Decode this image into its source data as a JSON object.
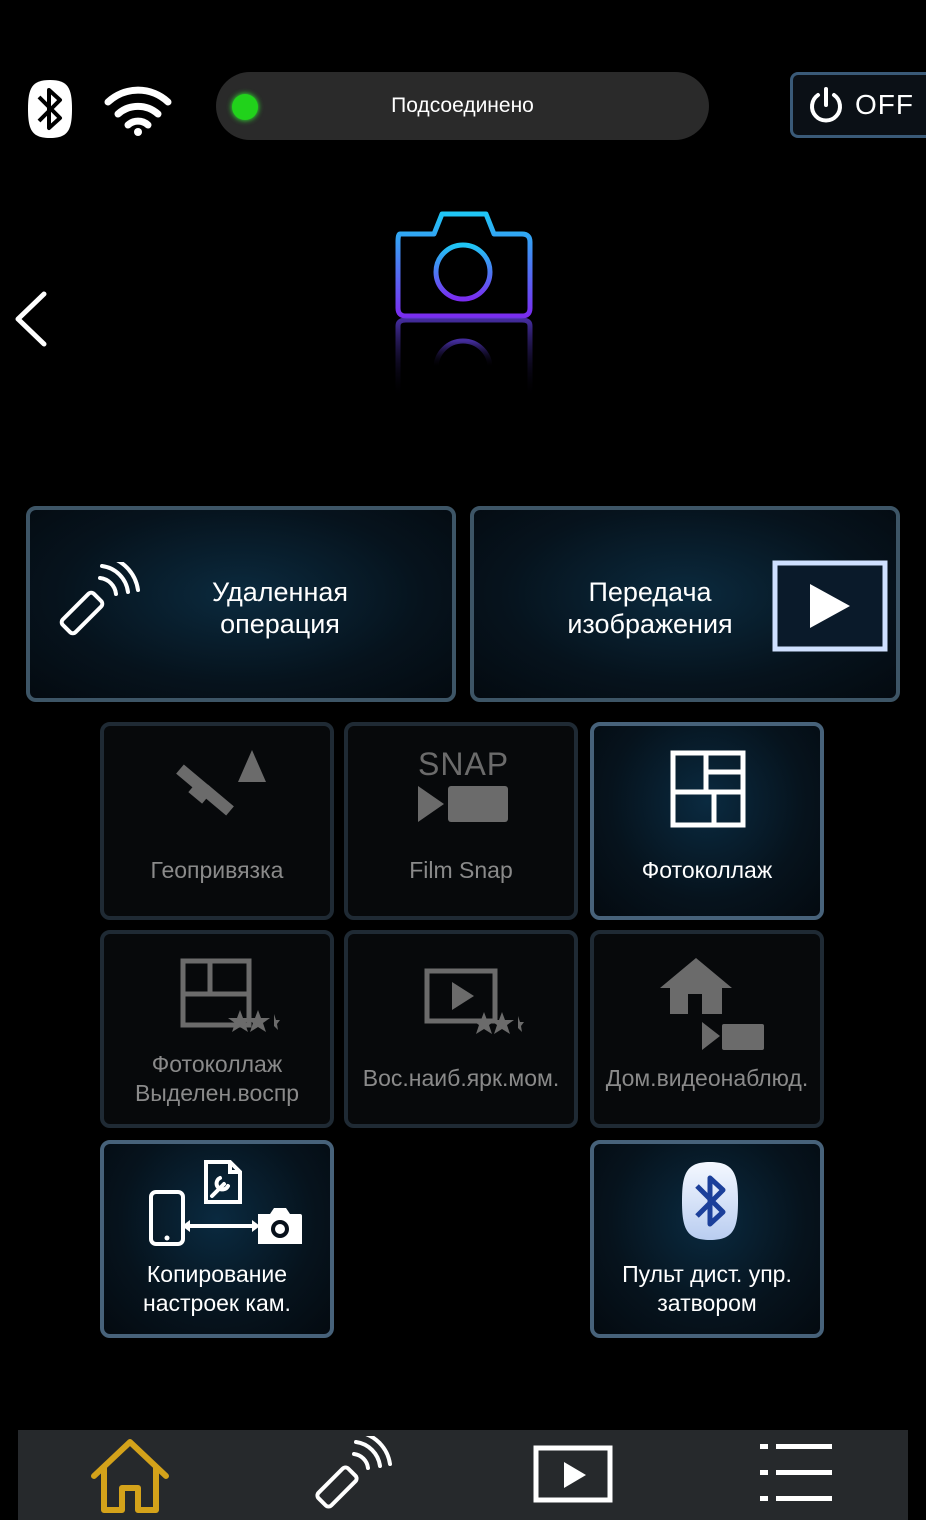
{
  "status": {
    "connection_text": "Подсоединено",
    "power_label": "OFF"
  },
  "main": {
    "big_tiles": [
      {
        "label_line1": "Удаленная",
        "label_line2": "операция"
      },
      {
        "label_line1": "Передача",
        "label_line2": "изображения"
      }
    ],
    "tiles": [
      {
        "label": "Геопривязка",
        "state": "disabled"
      },
      {
        "label": "Film Snap",
        "icon_text": "SNAP",
        "state": "disabled"
      },
      {
        "label": "Фотоколлаж",
        "state": "enabled"
      },
      {
        "label_line1": "Фотоколлаж",
        "label_line2": "Выделен.воспр",
        "state": "disabled"
      },
      {
        "label": "Вос.наиб.ярк.мом.",
        "state": "disabled"
      },
      {
        "label": "Дом.видеонаблюд.",
        "state": "disabled"
      },
      {
        "label_line1": "Копирование",
        "label_line2": "настроек кам.",
        "state": "enabled"
      },
      {
        "label_line1": "Пульт дист. упр.",
        "label_line2": "затвором",
        "state": "enabled"
      }
    ]
  },
  "bottom_nav": [
    "home-icon",
    "remote-icon",
    "playback-icon",
    "menu-icon"
  ],
  "colors": {
    "accent_home": "#d4a21a",
    "connected": "#21d21b",
    "tile_border": "#3d5566"
  }
}
